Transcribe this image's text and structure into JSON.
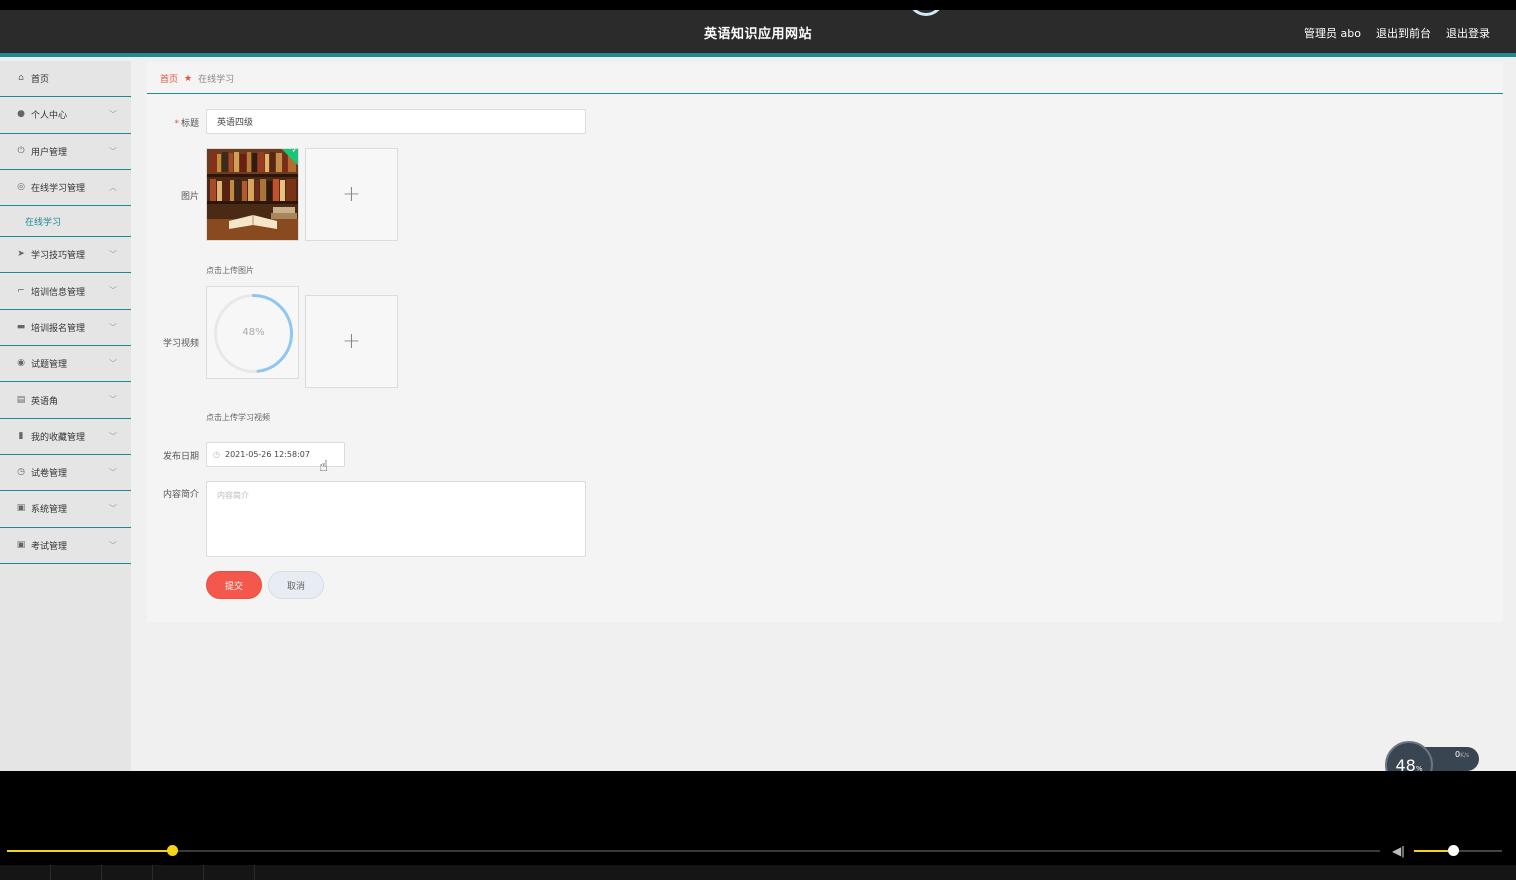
{
  "header": {
    "site_title": "英语知识应用网站",
    "user": "管理员 abo",
    "to_front": "退出到前台",
    "logout": "退出登录"
  },
  "sidebar": {
    "items": [
      {
        "label": "首页",
        "icon": "home-icon",
        "arrow": ""
      },
      {
        "label": "个人中心",
        "icon": "user-icon",
        "arrow": "﹀"
      },
      {
        "label": "用户管理",
        "icon": "power-icon",
        "arrow": "﹀"
      },
      {
        "label": "在线学习管理",
        "icon": "compass-icon",
        "arrow": "︿"
      },
      {
        "label": "学习技巧管理",
        "icon": "send-icon",
        "arrow": "﹀"
      },
      {
        "label": "培训信息管理",
        "icon": "crop-icon",
        "arrow": "﹀"
      },
      {
        "label": "培训报名管理",
        "icon": "chat-icon",
        "arrow": "﹀"
      },
      {
        "label": "试题管理",
        "icon": "globe-icon",
        "arrow": "﹀"
      },
      {
        "label": "英语角",
        "icon": "briefcase-icon",
        "arrow": "﹀"
      },
      {
        "label": "我的收藏管理",
        "icon": "book-icon",
        "arrow": "﹀"
      },
      {
        "label": "试卷管理",
        "icon": "clock-icon",
        "arrow": "﹀"
      },
      {
        "label": "系统管理",
        "icon": "clipboard-icon",
        "arrow": "﹀"
      },
      {
        "label": "考试管理",
        "icon": "clipboard-icon",
        "arrow": "﹀"
      }
    ],
    "sub_item": "在线学习"
  },
  "breadcrumb": {
    "home": "首页",
    "current": "在线学习"
  },
  "form": {
    "title_label": "标题",
    "title_value": "英语四级",
    "image_label": "图片",
    "image_hint": "点击上传图片",
    "video_label": "学习视频",
    "video_progress": 48,
    "video_progress_text": "48%",
    "video_hint": "点击上传学习视频",
    "date_label": "发布日期",
    "date_value": "2021-05-26 12:58:07",
    "intro_label": "内容简介",
    "intro_placeholder": "内容简介",
    "submit": "提交",
    "cancel": "取消"
  },
  "widget": {
    "percent": "48",
    "percent_unit": "%",
    "speed": "0",
    "speed_unit": "K/s"
  },
  "player": {
    "seek_fraction": 0.12,
    "volume_fraction": 0.44
  },
  "colors": {
    "accent": "#1e8a93",
    "submit": "#f4574c",
    "player": "#f5d318"
  }
}
